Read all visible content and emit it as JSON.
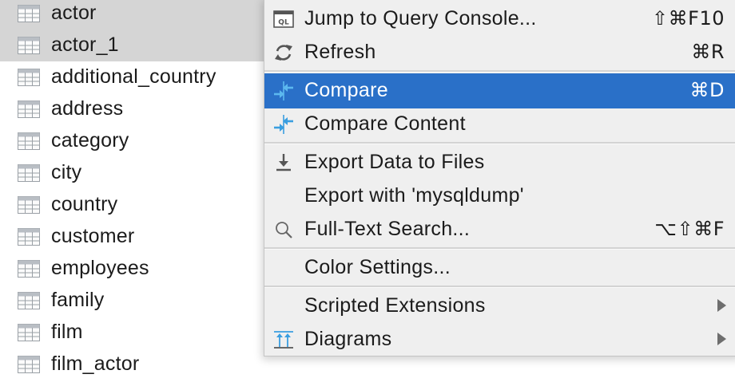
{
  "tree": {
    "items": [
      {
        "label": "actor",
        "selected": true
      },
      {
        "label": "actor_1",
        "selected": true
      },
      {
        "label": "additional_country",
        "selected": false
      },
      {
        "label": "address",
        "selected": false
      },
      {
        "label": "category",
        "selected": false
      },
      {
        "label": "city",
        "selected": false
      },
      {
        "label": "country",
        "selected": false
      },
      {
        "label": "customer",
        "selected": false
      },
      {
        "label": "employees",
        "selected": false
      },
      {
        "label": "family",
        "selected": false
      },
      {
        "label": "film",
        "selected": false
      },
      {
        "label": "film_actor",
        "selected": false
      }
    ],
    "icon": "table-icon"
  },
  "menu": {
    "items": [
      {
        "label": "Jump to Query Console...",
        "shortcut": "⇧⌘F10",
        "icon": "query-console-icon",
        "highlighted": false
      },
      {
        "label": "Refresh",
        "shortcut": "⌘R",
        "icon": "refresh-icon",
        "highlighted": false
      },
      {
        "label": "Compare",
        "shortcut": "⌘D",
        "icon": "compare-icon",
        "highlighted": true
      },
      {
        "label": "Compare Content",
        "shortcut": "",
        "icon": "compare-icon",
        "highlighted": false
      },
      {
        "label": "Export Data to Files",
        "shortcut": "",
        "icon": "export-icon",
        "highlighted": false
      },
      {
        "label": "Export with 'mysqldump'",
        "shortcut": "",
        "icon": "",
        "highlighted": false
      },
      {
        "label": "Full-Text Search...",
        "shortcut": "⌥⇧⌘F",
        "icon": "search-icon",
        "highlighted": false
      },
      {
        "label": "Color Settings...",
        "shortcut": "",
        "icon": "",
        "highlighted": false
      },
      {
        "label": "Scripted Extensions",
        "shortcut": "",
        "icon": "",
        "highlighted": false,
        "submenu": true
      },
      {
        "label": "Diagrams",
        "shortcut": "",
        "icon": "diagram-icon",
        "highlighted": false,
        "submenu": true
      }
    ]
  },
  "colors": {
    "highlight": "#2a70c8",
    "menu_bg": "#efefef",
    "selected_row": "#d5d5d5",
    "icon_blue": "#3a9ee0"
  }
}
